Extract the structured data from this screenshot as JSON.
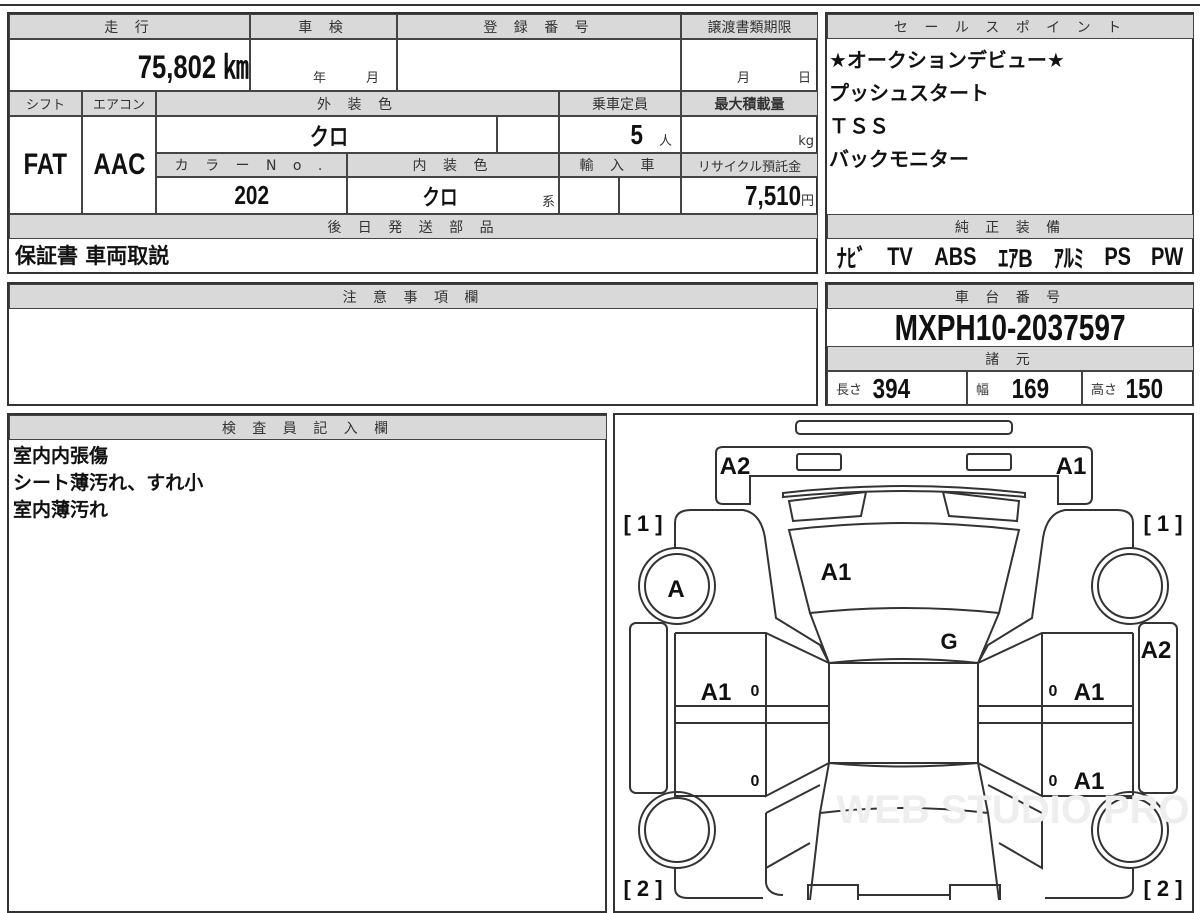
{
  "vehicle": {
    "mileage_header": "走 行",
    "mileage": "75,802 ㎞",
    "inspection_header": "車 検",
    "inspection_year_unit": "年",
    "inspection_month_unit": "月",
    "registration_header": "登 録 番 号",
    "transfer_deadline_header": "譲渡書類期限",
    "transfer_month_unit": "月",
    "transfer_day_unit": "日",
    "shift_header": "シフト",
    "shift": "FAT",
    "ac_header": "エアコン",
    "ac": "AAC",
    "exterior_color_header": "外 装 色",
    "exterior_color": "クロ",
    "capacity_header": "乗車定員",
    "capacity": "5",
    "capacity_unit": "人",
    "max_load_header": "最大積載量",
    "max_load_unit": "kg",
    "color_no_header": "カ ラ ー N o .",
    "color_no": "202",
    "interior_color_header": "内 装 色",
    "interior_color": "クロ",
    "interior_color_suffix": "系",
    "import_header": "輸 入 車",
    "recycle_header": "リサイクル預託金",
    "recycle_fee": "7,510",
    "recycle_unit": "円",
    "later_parts_header": "後 日 発 送 部 品",
    "later_parts": "保証書 車両取説"
  },
  "sales_points": {
    "header": "セ ー ル ス ポ イ ン ト",
    "items": [
      "★オークションデビュー★",
      "プッシュスタート",
      "ＴＳＳ",
      "バックモニター"
    ]
  },
  "equipment": {
    "header": "純 正 装 備",
    "items": [
      "ﾅﾋﾞ",
      "TV",
      "ABS",
      "ｴｱB",
      "ｱﾙﾐ",
      "PS",
      "PW"
    ]
  },
  "notes": {
    "header": "注 意 事 項 欄"
  },
  "chassis": {
    "header": "車 台 番 号",
    "number": "MXPH10-2037597"
  },
  "specs": {
    "header": "諸 元",
    "length_label": "長さ",
    "length": "394",
    "width_label": "幅",
    "width": "169",
    "height_label": "高さ",
    "height": "150"
  },
  "inspector": {
    "header": "検 査 員 記 入 欄",
    "lines": [
      "室内内張傷",
      "シート薄汚れ、すれ小",
      "室内薄汚れ"
    ]
  },
  "diagram": {
    "marks": [
      "A2",
      "A1",
      "[ 1 ]",
      "[ 1 ]",
      "A1",
      "A",
      "G",
      "A2",
      "A1",
      "0",
      "0",
      "A1",
      "0",
      "0",
      "A1",
      "[ 2 ]",
      "[ 2 ]"
    ],
    "watermark": "WEB STUDIO PRO"
  }
}
